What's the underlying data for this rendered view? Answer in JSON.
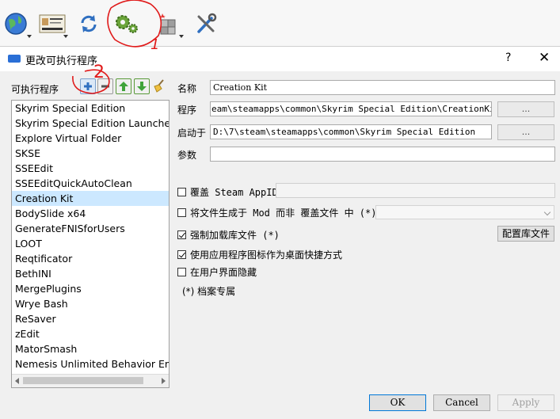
{
  "toolbar": {
    "icons": [
      "globe-icon",
      "profile-card-icon",
      "refresh-icon",
      "gear-icon",
      "plugin-icon",
      "tools-icon"
    ]
  },
  "dialog": {
    "title": "更改可执行程序",
    "help": "?",
    "close": "✕"
  },
  "list": {
    "label": "可执行程序",
    "items": [
      "Skyrim Special Edition",
      "Skyrim Special Edition Launcher",
      "Explore Virtual Folder",
      "SKSE",
      "SSEEdit",
      "SSEEditQuickAutoClean",
      "Creation Kit",
      "BodySlide x64",
      "GenerateFNISforUsers",
      "LOOT",
      "Reqtificator",
      "BethINI",
      "MergePlugins",
      "Wrye Bash",
      "ReSaver",
      "zEdit",
      "MatorSmash",
      "Nemesis Unlimited Behavior Engine"
    ],
    "selected": "Creation Kit"
  },
  "form": {
    "name_label": "名称",
    "name_value": "Creation Kit",
    "program_label": "程序",
    "program_value": "eam\\steamapps\\common\\Skyrim Special Edition\\CreationKit.exe",
    "startin_label": "启动于",
    "startin_value": "D:\\7\\steam\\steamapps\\common\\Skyrim Special Edition",
    "args_label": "参数",
    "args_value": "",
    "browse_label": "..."
  },
  "options": {
    "steam_appid_label": "覆盖 Steam AppID",
    "steam_appid_value": "",
    "mod_output_label": "将文件生成于 Mod 而非 覆盖文件 中 (*)",
    "force_load_label": "强制加载库文件 (*)",
    "config_libs_label": "配置库文件",
    "use_icon_label": "使用应用程序图标作为桌面快捷方式",
    "hide_ui_label": "在用户界面隐藏",
    "note": "(*) 档案专属",
    "checked": {
      "steam_appid": false,
      "mod_output": false,
      "force_load": true,
      "use_icon": true,
      "hide_ui": false
    }
  },
  "buttons": {
    "ok": "OK",
    "cancel": "Cancel",
    "apply": "Apply"
  },
  "annotations": {
    "label_1": "1",
    "label_2": "2",
    "color": "#e01b1b"
  }
}
